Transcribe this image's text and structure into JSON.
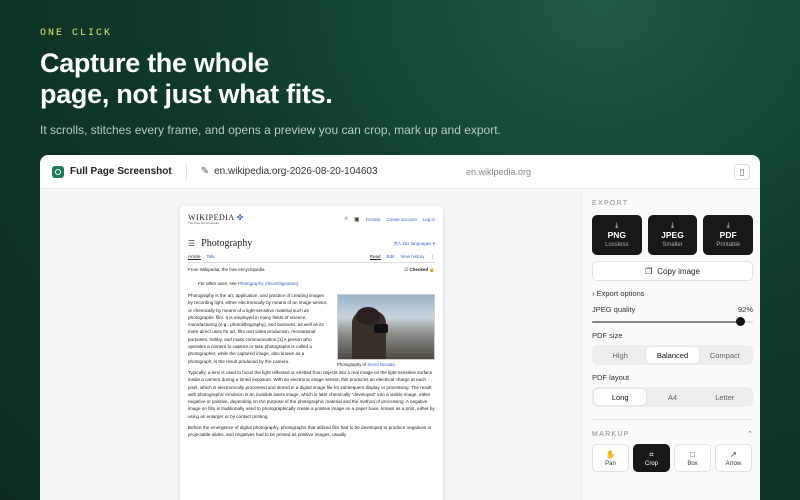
{
  "hero": {
    "eyebrow": "ONE CLICK",
    "headline_line1": "Capture the whole",
    "headline_line2": "page, not just what fits.",
    "subtitle": "It scrolls, stitches every frame, and opens a preview you can crop, mark up and export."
  },
  "window": {
    "app_name": "Full Page Screenshot",
    "file_name": "en.wikipedia.org-2026-08-20-104603",
    "domain": "en.wikipedia.org",
    "icons": {
      "app": "camera-icon",
      "edit": "pencil-icon",
      "panel": "sidebar-toggle-icon"
    }
  },
  "page": {
    "logo": "WIKIPEDIA",
    "tagline": "The Free Encyclopedia",
    "tools": [
      "Donate",
      "Create account",
      "Log in"
    ],
    "title": "Photography",
    "languages": "152 languages",
    "tabs_left": [
      "Article",
      "Talk"
    ],
    "tabs_right": [
      "Read",
      "Edit",
      "View history"
    ],
    "from": "From Wikipedia, the free encyclopedia",
    "checked": "Checked",
    "hatnote_prefix": "For other uses, see",
    "hatnote_link": "Photography (disambiguation).",
    "caption_prefix": "Photography of",
    "caption_link": "Sierra Nevada",
    "para1": "Photography is the art, application, and practice of creating images by recording light, either electronically by means of an image sensor, or chemically by means of a light-sensitive material such as photographic film. It is employed in many fields of science, manufacturing (e.g., photolithography), and business, as well as its more direct uses for art, film and video production, recreational purposes, hobby, and mass communication.[1] A person who operates a camera to capture or take photographs is called a photographer, while the captured image, also known as a photograph, is the result produced by the camera.",
    "para2": "Typically, a lens is used to focus the light reflected or emitted from objects into a real image on the light-sensitive surface inside a camera during a timed exposure. With an electronic image sensor, this produces an electrical charge at each pixel, which is electronically processed and stored in a digital image file for subsequent display or processing. The result with photographic emulsion is an invisible latent image, which is later chemically \"developed\" into a visible image, either negative or positive, depending on the purpose of the photographic material and the method of processing. A negative image on film is traditionally used to photographically create a positive image on a paper base, known as a print, either by using an enlarger or by contact printing.",
    "para3": "Before the emergence of digital photography, photographs that utilized film had to be developed to produce negatives or projectable slides, and negatives had to be printed as positive images, usually"
  },
  "panel": {
    "export_label": "EXPORT",
    "export_buttons": [
      {
        "format": "PNG",
        "hint": "Lossless"
      },
      {
        "format": "JPEG",
        "hint": "Smaller"
      },
      {
        "format": "PDF",
        "hint": "Printable"
      }
    ],
    "copy_label": "Copy image",
    "export_options_label": "Export options",
    "jpeg_quality_label": "JPEG quality",
    "jpeg_quality_value": "92%",
    "jpeg_quality": 0.92,
    "pdf_size_label": "PDF size",
    "pdf_size_options": [
      "High",
      "Balanced",
      "Compact"
    ],
    "pdf_size_selected": "Balanced",
    "pdf_layout_label": "PDF layout",
    "pdf_layout_options": [
      "Long",
      "A4",
      "Letter"
    ],
    "pdf_layout_selected": "Long",
    "markup_label": "MARKUP",
    "tools": [
      {
        "name": "Pan",
        "icon": "pan-icon"
      },
      {
        "name": "Crop",
        "icon": "crop-icon"
      },
      {
        "name": "Box",
        "icon": "box-icon"
      },
      {
        "name": "Arrow",
        "icon": "arrow-icon"
      }
    ],
    "selected_tool": "Crop"
  },
  "colors": {
    "accent": "#e3e86a",
    "background": "#0f3a2c",
    "button_dark": "#181818"
  }
}
